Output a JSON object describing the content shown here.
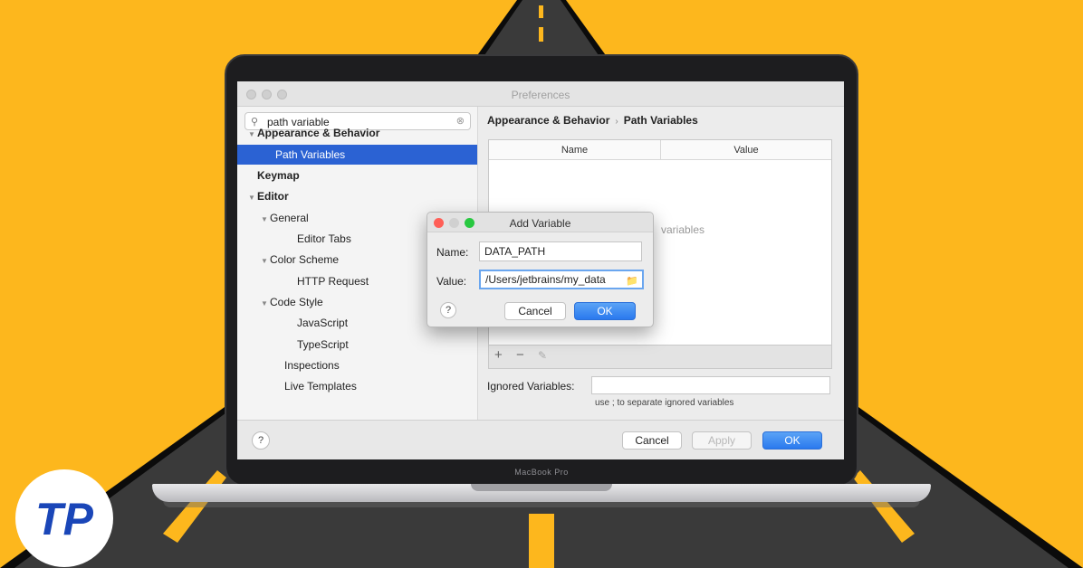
{
  "window": {
    "title": "Preferences"
  },
  "search": {
    "value": "path variable"
  },
  "tree": [
    {
      "label": "Appearance & Behavior",
      "bold": true,
      "caret": true,
      "selected": false
    },
    {
      "label": "Path Variables",
      "bold": false,
      "caret": false,
      "selected": true
    },
    {
      "label": "Keymap",
      "bold": true,
      "caret": false,
      "selected": false
    },
    {
      "label": "Editor",
      "bold": true,
      "caret": true,
      "selected": false
    },
    {
      "label": "General",
      "bold": false,
      "caret": true,
      "selected": false
    },
    {
      "label": "Editor Tabs",
      "bold": false,
      "caret": false,
      "selected": false
    },
    {
      "label": "Color Scheme",
      "bold": false,
      "caret": true,
      "selected": false
    },
    {
      "label": "HTTP Request",
      "bold": false,
      "caret": false,
      "selected": false
    },
    {
      "label": "Code Style",
      "bold": false,
      "caret": true,
      "selected": false
    },
    {
      "label": "JavaScript",
      "bold": false,
      "caret": false,
      "selected": false
    },
    {
      "label": "TypeScript",
      "bold": false,
      "caret": false,
      "selected": false
    },
    {
      "label": "Inspections",
      "bold": false,
      "caret": false,
      "selected": false
    },
    {
      "label": "Live Templates",
      "bold": false,
      "caret": false,
      "selected": false
    }
  ],
  "breadcrumb": {
    "parent": "Appearance & Behavior",
    "separator": "›",
    "current": "Path Variables"
  },
  "table": {
    "columns": [
      "Name",
      "Value"
    ],
    "empty_text": "variables"
  },
  "toolbar": {
    "add": "+",
    "remove": "−",
    "edit": "✎"
  },
  "ignored": {
    "label": "Ignored Variables:",
    "value": "",
    "hint": "use ; to separate ignored variables"
  },
  "buttons": {
    "help": "?",
    "cancel": "Cancel",
    "apply": "Apply",
    "ok": "OK"
  },
  "dialog": {
    "title": "Add Variable",
    "name_label": "Name:",
    "name_value": "DATA_PATH",
    "value_label": "Value:",
    "value_value": "/Users/jetbrains/my_data",
    "help": "?",
    "cancel": "Cancel",
    "ok": "OK"
  },
  "device": {
    "label": "MacBook Pro"
  },
  "logo": {
    "text": "TP"
  },
  "colors": {
    "background": "#FDB71D",
    "selection": "#2B62D3",
    "primary_button": "#2A79EE",
    "traffic_red": "#FF5F57",
    "traffic_yellow": "#FEBC2E",
    "traffic_green": "#28C840"
  }
}
